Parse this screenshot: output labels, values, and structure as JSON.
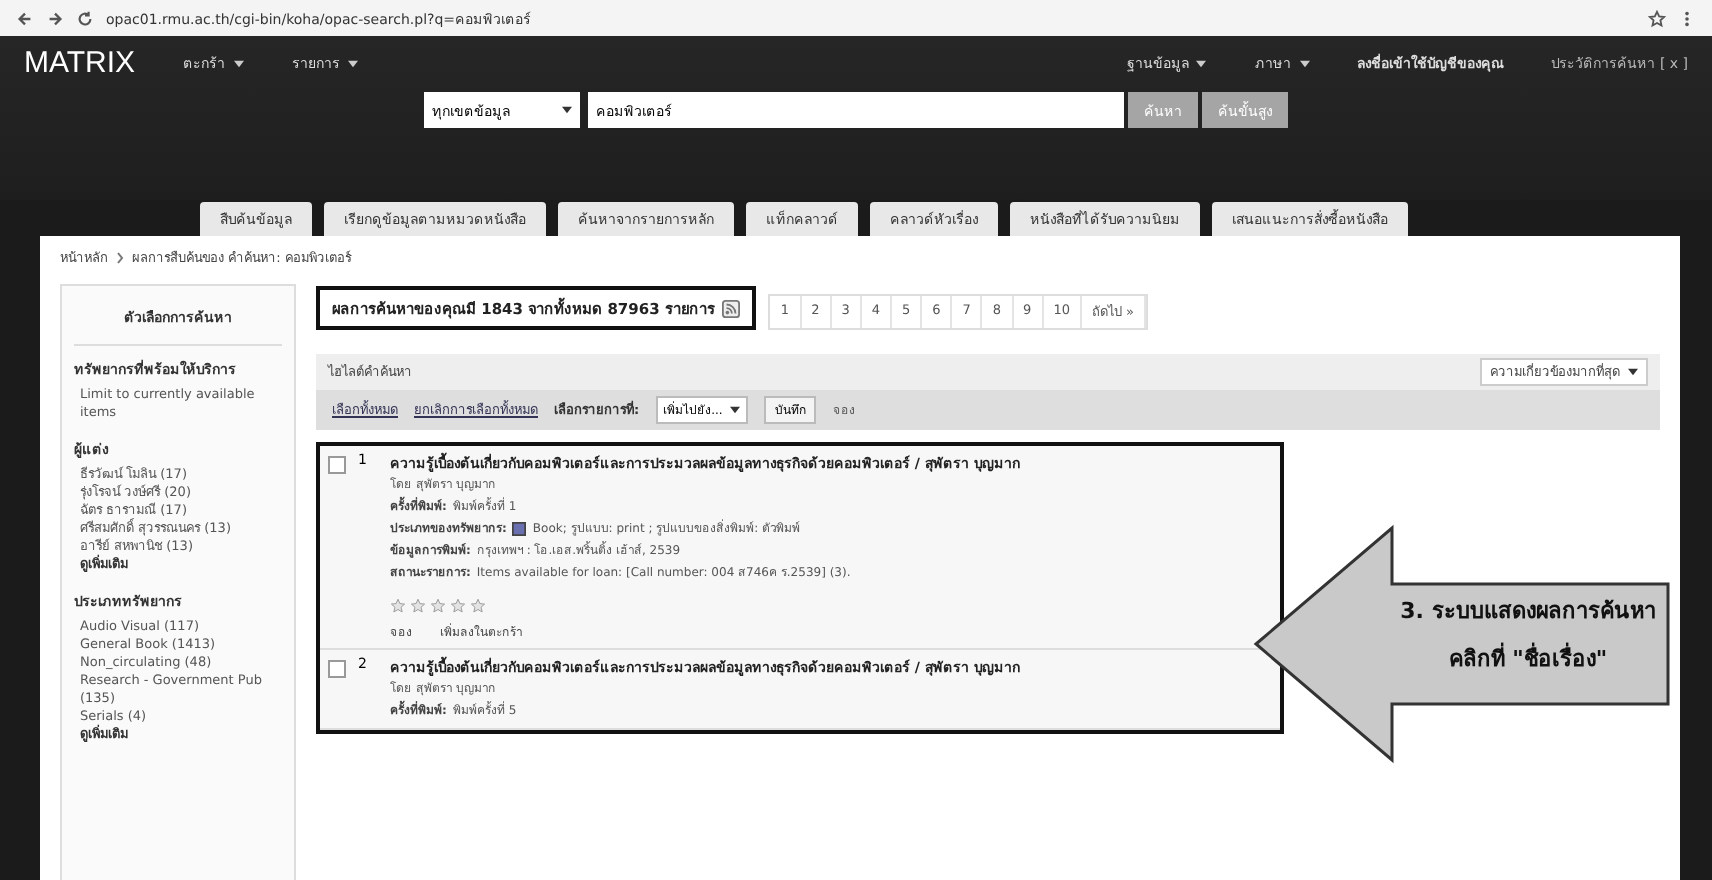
{
  "browser": {
    "url": "opac01.rmu.ac.th/cgi-bin/koha/opac-search.pl?q=คอมพิวเตอร์"
  },
  "header": {
    "logo": "MATRIX",
    "left_menus": [
      "ตะกร้า",
      "รายการ"
    ],
    "right_menus": [
      "ฐานข้อมูล",
      "ภาษา"
    ],
    "login": "ลงชื่อเข้าใช้บัญชีของคุณ",
    "history": "ประวัติการค้นหา [ x ]"
  },
  "search": {
    "scope": "ทุกเขตข้อมูล",
    "query": "คอมพิวเตอร์",
    "buttons": [
      "ค้นหา",
      "ค้นขั้นสูง"
    ]
  },
  "tabs": [
    {
      "label": "สืบค้นข้อมูล"
    },
    {
      "label": "เรียกดูข้อมูลตามหมวดหนังสือ"
    },
    {
      "label": "ค้นหาจากรายการหลัก"
    },
    {
      "label": "แท็กคลาวด์"
    },
    {
      "label": "คลาวด์หัวเรื่อง"
    },
    {
      "label": "หนังสือที่ได้รับความนิยม"
    },
    {
      "label": "เสนอแนะการสั่งซื้อหนังสือ"
    }
  ],
  "breadcrumb": [
    "หน้าหลัก",
    "ผลการสืบค้นของ คำค้นหา: คอมพิวเตอร์"
  ],
  "sidebar": {
    "title": "ตัวเลือกการค้นหา",
    "sections": [
      {
        "heading": "ทรัพยากรที่พร้อมให้บริการ",
        "items": [
          {
            "label": "Limit to currently available items",
            "kind": "link"
          }
        ]
      },
      {
        "heading": "ผู้แต่ง",
        "items": [
          {
            "label": "ธีรวัฒน์ โมลิน (17)",
            "kind": "link"
          },
          {
            "label": "รุ่งโรจน์ วงษ์ศรี (20)",
            "kind": "link"
          },
          {
            "label": "ฉัตร ธารามณี (17)",
            "kind": "link"
          },
          {
            "label": "ศรีสมศักดิ์ สุวรรณนคร (13)",
            "kind": "link"
          },
          {
            "label": "อารีย์ สหพานิช (13)",
            "kind": "link"
          },
          {
            "label": "ดูเพิ่มเติม",
            "kind": "more"
          }
        ]
      },
      {
        "heading": "ประเภททรัพยากร",
        "items": [
          {
            "label": "Audio Visual (117)",
            "kind": "link"
          },
          {
            "label": "General Book (1413)",
            "kind": "link"
          },
          {
            "label": "Non_circulating (48)",
            "kind": "link"
          },
          {
            "label": "Research - Government Pub (135)",
            "kind": "link"
          },
          {
            "label": "Serials (4)",
            "kind": "link"
          },
          {
            "label": "ดูเพิ่มเติม",
            "kind": "more"
          }
        ]
      }
    ]
  },
  "results": {
    "summary": "ผลการค้นหาของคุณมี 1843 จากทั้งหมด 87963 รายการ",
    "pages": [
      "1",
      "2",
      "3",
      "4",
      "5",
      "6",
      "7",
      "8",
      "9",
      "10"
    ],
    "next": "ถัดไป »",
    "highlight": "ไฮไลต์คำค้นหา",
    "sort": "ความเกี่ยวข้องมากที่สุด",
    "toolbar": {
      "select_all": "เลือกทั้งหมด",
      "clear_all": "ยกเลิกการเลือกทั้งหมด",
      "select_label": "เลือกรายการที่:",
      "add_to": "เพิ่มไปยัง...",
      "save": "บันทึก",
      "hold": "จอง"
    },
    "items": [
      {
        "number": "1",
        "checked": false,
        "title": "ความรู้เบื้องต้นเกี่ยวกับคอมพิวเตอร์และการประมวลผลข้อมูลทางธุรกิจด้วยคอมพิวเตอร์ / สุพัตรา บุญมาก",
        "author": "โดย สุพัตรา บุญมาก",
        "lines": [
          {
            "label": "ครั้งที่พิมพ์:",
            "value": "พิมพ์ครั้งที่ 1"
          },
          {
            "label": "ประเภทของทรัพยากร:",
            "value": "Book; รูปแบบ: print ; รูปแบบของสิ่งพิมพ์: ตัวพิมพ์",
            "kind": "type"
          },
          {
            "label": "ข้อมูลการพิมพ์:",
            "value": "กรุงเทพฯ : โอ.เอส.พริ้นติ้ง เฮ้าส์, 2539"
          },
          {
            "label": "สถานะรายการ:",
            "value": "Items available for loan: [Call number: 004 ส746ค ร.2539] (3)."
          }
        ],
        "stars": 0,
        "actions": [
          "จอง",
          "เพิ่มลงในตะกร้า"
        ]
      },
      {
        "number": "2",
        "checked": false,
        "title": "ความรู้เบื้องต้นเกี่ยวกับคอมพิวเตอร์และการประมวลผลข้อมูลทางธุรกิจด้วยคอมพิวเตอร์ / สุพัตรา บุญมาก",
        "author": "โดย สุพัตรา บุญมาก",
        "lines": [
          {
            "label": "ครั้งที่พิมพ์:",
            "value": "พิมพ์ครั้งที่ 5"
          }
        ]
      }
    ]
  },
  "annotation": {
    "lines": [
      "3. ระบบแสดงผลการค้นหา",
      "คลิกที่ \"ชื่อเรื่อง\""
    ]
  }
}
